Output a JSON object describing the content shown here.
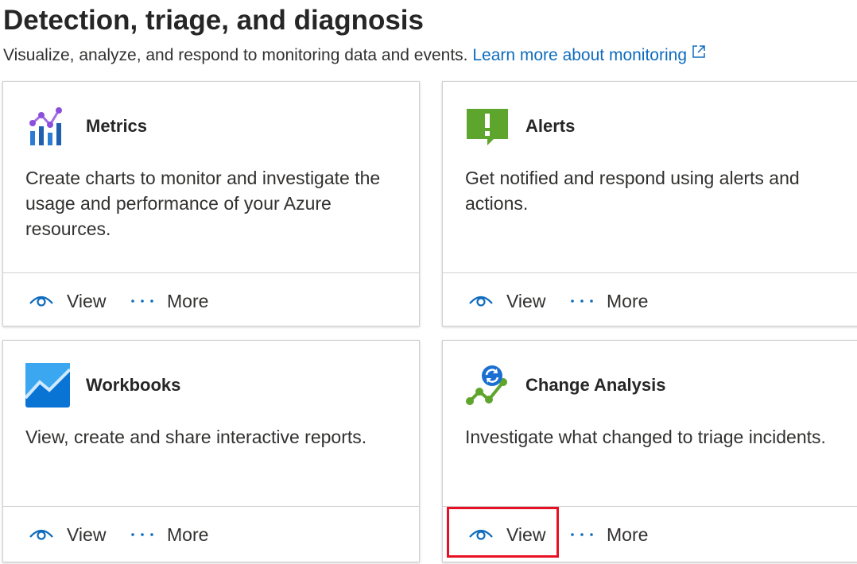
{
  "header": {
    "title": "Detection, triage, and diagnosis",
    "subtitle": "Visualize, analyze, and respond to monitoring data and events.",
    "learn_more_link": "Learn more about monitoring"
  },
  "cards": [
    {
      "title": "Metrics",
      "description": "Create charts to monitor and investigate the usage and performance of your Azure resources.",
      "icon": "metrics-icon",
      "view_label": "View",
      "more_label": "More"
    },
    {
      "title": "Alerts",
      "description": "Get notified and respond using alerts and actions.",
      "icon": "alerts-icon",
      "view_label": "View",
      "more_label": "More"
    },
    {
      "title": "Workbooks",
      "description": "View, create and share interactive reports.",
      "icon": "workbooks-icon",
      "view_label": "View",
      "more_label": "More"
    },
    {
      "title": "Change Analysis",
      "description": "Investigate what changed to triage incidents.",
      "icon": "change-analysis-icon",
      "view_label": "View",
      "more_label": "More"
    }
  ],
  "colors": {
    "link": "#0f6cbd",
    "highlight": "#e81123",
    "alerts_green": "#5ea52d",
    "workbooks_blue": "#0a74d4"
  }
}
